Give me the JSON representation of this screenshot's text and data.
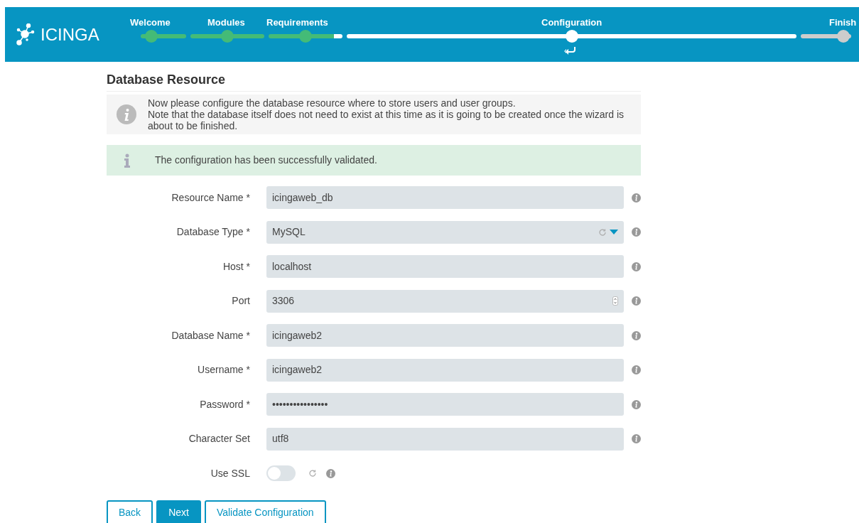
{
  "header": {
    "logo_text": "ICINGA",
    "steps": [
      {
        "label": "Welcome",
        "completed": true,
        "selected": false
      },
      {
        "label": "Modules",
        "completed": true,
        "selected": false
      },
      {
        "label": "Requirements",
        "completed": true,
        "selected": false
      },
      {
        "label": "Configuration",
        "completed": false,
        "selected": true
      },
      {
        "label": "Finish",
        "completed": false,
        "selected": false
      }
    ]
  },
  "title": "Database Resource",
  "info": [
    "Now please configure the database resource where to store users and user groups.",
    "Note that the database itself does not need to exist at this time as it is going to be created once the wizard is about to be finished."
  ],
  "success": "The configuration has been successfully validated.",
  "fields": [
    {
      "kind": "text",
      "label": "Resource Name *",
      "value": "icingaweb_db"
    },
    {
      "kind": "select",
      "label": "Database Type *",
      "value": "MySQL"
    },
    {
      "kind": "text",
      "label": "Host *",
      "value": "localhost"
    },
    {
      "kind": "number",
      "label": "Port",
      "value": "3306"
    },
    {
      "kind": "text",
      "label": "Database Name *",
      "value": "icingaweb2"
    },
    {
      "kind": "text",
      "label": "Username *",
      "value": "icingaweb2"
    },
    {
      "kind": "text",
      "label": "Password *",
      "value": "••••••••••••••••"
    },
    {
      "kind": "text",
      "label": "Character Set",
      "value": "utf8"
    },
    {
      "kind": "toggle",
      "label": "Use SSL",
      "on": false
    }
  ],
  "buttons": [
    {
      "label": "Back",
      "kind": "outline"
    },
    {
      "label": "Next",
      "kind": "primary"
    },
    {
      "label": "Validate Configuration",
      "kind": "outline"
    }
  ]
}
